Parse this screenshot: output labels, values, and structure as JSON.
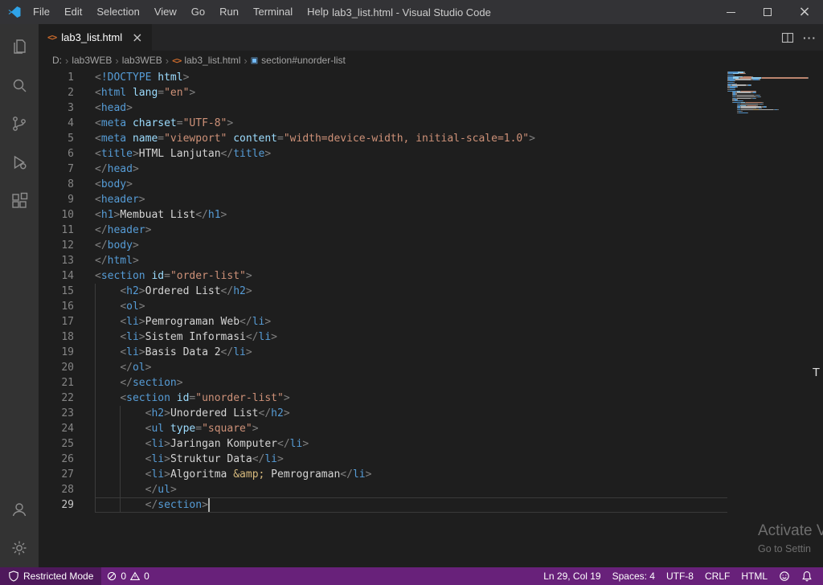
{
  "window": {
    "title": "lab3_list.html - Visual Studio Code",
    "menus": [
      "File",
      "Edit",
      "Selection",
      "View",
      "Go",
      "Run",
      "Terminal",
      "Help"
    ],
    "controls": [
      "minimize",
      "maximize",
      "close"
    ]
  },
  "activity_bar": {
    "top_icons": [
      "explorer",
      "search",
      "source-control",
      "run-and-debug",
      "extensions"
    ],
    "bottom_icons": [
      "accounts",
      "settings"
    ]
  },
  "tabs": {
    "active": {
      "label": "lab3_list.html"
    }
  },
  "breadcrumb": {
    "separator": "›",
    "items": [
      {
        "label": "D:"
      },
      {
        "label": "lab3WEB"
      },
      {
        "label": "lab3WEB"
      },
      {
        "label": "lab3_list.html",
        "icon": "html"
      },
      {
        "label": "section#unorder-list",
        "icon": "symbol"
      }
    ]
  },
  "icons": {
    "html_file_glyph": "<>",
    "symbol_glyph": "▣",
    "close_glyph": "×",
    "more_glyph": "···"
  },
  "editor": {
    "cursor": {
      "line": 29,
      "col": 19
    },
    "lines": [
      [
        [
          "p",
          "<"
        ],
        [
          "tag",
          "!DOCTYPE"
        ],
        [
          "attr",
          " html"
        ],
        [
          "p",
          ">"
        ]
      ],
      [
        [
          "p",
          "<"
        ],
        [
          "tag",
          "html"
        ],
        [
          "attr",
          " lang"
        ],
        [
          "p",
          "="
        ],
        [
          "str",
          "\"en\""
        ],
        [
          "p",
          ">"
        ]
      ],
      [
        [
          "p",
          "<"
        ],
        [
          "tag",
          "head"
        ],
        [
          "p",
          ">"
        ]
      ],
      [
        [
          "p",
          "<"
        ],
        [
          "tag",
          "meta"
        ],
        [
          "attr",
          " charset"
        ],
        [
          "p",
          "="
        ],
        [
          "str",
          "\"UTF-8\""
        ],
        [
          "p",
          ">"
        ]
      ],
      [
        [
          "p",
          "<"
        ],
        [
          "tag",
          "meta"
        ],
        [
          "attr",
          " name"
        ],
        [
          "p",
          "="
        ],
        [
          "str",
          "\"viewport\""
        ],
        [
          "attr",
          " content"
        ],
        [
          "p",
          "="
        ],
        [
          "str",
          "\"width=device-width, initial-scale=1.0\""
        ],
        [
          "p",
          ">"
        ]
      ],
      [
        [
          "p",
          "<"
        ],
        [
          "tag",
          "title"
        ],
        [
          "p",
          ">"
        ],
        [
          "txt",
          "HTML Lanjutan"
        ],
        [
          "p",
          "</"
        ],
        [
          "tag",
          "title"
        ],
        [
          "p",
          ">"
        ]
      ],
      [
        [
          "p",
          "</"
        ],
        [
          "tag",
          "head"
        ],
        [
          "p",
          ">"
        ]
      ],
      [
        [
          "p",
          "<"
        ],
        [
          "tag",
          "body"
        ],
        [
          "p",
          ">"
        ]
      ],
      [
        [
          "p",
          "<"
        ],
        [
          "tag",
          "header"
        ],
        [
          "p",
          ">"
        ]
      ],
      [
        [
          "p",
          "<"
        ],
        [
          "tag",
          "h1"
        ],
        [
          "p",
          ">"
        ],
        [
          "txt",
          "Membuat List"
        ],
        [
          "p",
          "</"
        ],
        [
          "tag",
          "h1"
        ],
        [
          "p",
          ">"
        ]
      ],
      [
        [
          "p",
          "</"
        ],
        [
          "tag",
          "header"
        ],
        [
          "p",
          ">"
        ]
      ],
      [
        [
          "p",
          "</"
        ],
        [
          "tag",
          "body"
        ],
        [
          "p",
          ">"
        ]
      ],
      [
        [
          "p",
          "</"
        ],
        [
          "tag",
          "html"
        ],
        [
          "p",
          ">"
        ]
      ],
      [
        [
          "p",
          "<"
        ],
        [
          "tag",
          "section"
        ],
        [
          "attr",
          " id"
        ],
        [
          "p",
          "="
        ],
        [
          "str",
          "\"order-list\""
        ],
        [
          "p",
          ">"
        ]
      ],
      [
        [
          "ws",
          "    "
        ],
        [
          "p",
          "<"
        ],
        [
          "tag",
          "h2"
        ],
        [
          "p",
          ">"
        ],
        [
          "txt",
          "Ordered List"
        ],
        [
          "p",
          "</"
        ],
        [
          "tag",
          "h2"
        ],
        [
          "p",
          ">"
        ]
      ],
      [
        [
          "ws",
          "    "
        ],
        [
          "p",
          "<"
        ],
        [
          "tag",
          "ol"
        ],
        [
          "p",
          ">"
        ]
      ],
      [
        [
          "ws",
          "    "
        ],
        [
          "p",
          "<"
        ],
        [
          "tag",
          "li"
        ],
        [
          "p",
          ">"
        ],
        [
          "txt",
          "Pemrograman Web"
        ],
        [
          "p",
          "</"
        ],
        [
          "tag",
          "li"
        ],
        [
          "p",
          ">"
        ]
      ],
      [
        [
          "ws",
          "    "
        ],
        [
          "p",
          "<"
        ],
        [
          "tag",
          "li"
        ],
        [
          "p",
          ">"
        ],
        [
          "txt",
          "Sistem Informasi"
        ],
        [
          "p",
          "</"
        ],
        [
          "tag",
          "li"
        ],
        [
          "p",
          ">"
        ]
      ],
      [
        [
          "ws",
          "    "
        ],
        [
          "p",
          "<"
        ],
        [
          "tag",
          "li"
        ],
        [
          "p",
          ">"
        ],
        [
          "txt",
          "Basis Data 2"
        ],
        [
          "p",
          "</"
        ],
        [
          "tag",
          "li"
        ],
        [
          "p",
          ">"
        ]
      ],
      [
        [
          "ws",
          "    "
        ],
        [
          "p",
          "</"
        ],
        [
          "tag",
          "ol"
        ],
        [
          "p",
          ">"
        ]
      ],
      [
        [
          "ws",
          "    "
        ],
        [
          "p",
          "</"
        ],
        [
          "tag",
          "section"
        ],
        [
          "p",
          ">"
        ]
      ],
      [
        [
          "ws",
          "    "
        ],
        [
          "p",
          "<"
        ],
        [
          "tag",
          "section"
        ],
        [
          "attr",
          " id"
        ],
        [
          "p",
          "="
        ],
        [
          "str",
          "\"unorder-list\""
        ],
        [
          "p",
          ">"
        ]
      ],
      [
        [
          "ws",
          "        "
        ],
        [
          "p",
          "<"
        ],
        [
          "tag",
          "h2"
        ],
        [
          "p",
          ">"
        ],
        [
          "txt",
          "Unordered List"
        ],
        [
          "p",
          "</"
        ],
        [
          "tag",
          "h2"
        ],
        [
          "p",
          ">"
        ]
      ],
      [
        [
          "ws",
          "        "
        ],
        [
          "p",
          "<"
        ],
        [
          "tag",
          "ul"
        ],
        [
          "attr",
          " type"
        ],
        [
          "p",
          "="
        ],
        [
          "str",
          "\"square\""
        ],
        [
          "p",
          ">"
        ]
      ],
      [
        [
          "ws",
          "        "
        ],
        [
          "p",
          "<"
        ],
        [
          "tag",
          "li"
        ],
        [
          "p",
          ">"
        ],
        [
          "txt",
          "Jaringan Komputer"
        ],
        [
          "p",
          "</"
        ],
        [
          "tag",
          "li"
        ],
        [
          "p",
          ">"
        ]
      ],
      [
        [
          "ws",
          "        "
        ],
        [
          "p",
          "<"
        ],
        [
          "tag",
          "li"
        ],
        [
          "p",
          ">"
        ],
        [
          "txt",
          "Struktur Data"
        ],
        [
          "p",
          "</"
        ],
        [
          "tag",
          "li"
        ],
        [
          "p",
          ">"
        ]
      ],
      [
        [
          "ws",
          "        "
        ],
        [
          "p",
          "<"
        ],
        [
          "tag",
          "li"
        ],
        [
          "p",
          ">"
        ],
        [
          "txt",
          "Algoritma "
        ],
        [
          "ent",
          "&amp;"
        ],
        [
          "txt",
          " Pemrograman"
        ],
        [
          "p",
          "</"
        ],
        [
          "tag",
          "li"
        ],
        [
          "p",
          ">"
        ]
      ],
      [
        [
          "ws",
          "        "
        ],
        [
          "p",
          "</"
        ],
        [
          "tag",
          "ul"
        ],
        [
          "p",
          ">"
        ]
      ],
      [
        [
          "ws",
          "        "
        ],
        [
          "p",
          "</"
        ],
        [
          "tag",
          "section"
        ],
        [
          "p",
          ">"
        ]
      ]
    ]
  },
  "status_bar": {
    "restricted_label": "Restricted Mode",
    "errors": "0",
    "warnings": "0",
    "right": [
      {
        "name": "cursor-position",
        "label": "Ln 29, Col 19"
      },
      {
        "name": "indentation",
        "label": "Spaces: 4"
      },
      {
        "name": "encoding",
        "label": "UTF-8"
      },
      {
        "name": "eol",
        "label": "CRLF"
      },
      {
        "name": "language-mode",
        "label": "HTML"
      }
    ]
  },
  "overlay": {
    "glyph": "T"
  },
  "watermark": {
    "line1": "Activate V",
    "line2": "Go to Settin"
  },
  "colors": {
    "status_bar": "#68217A",
    "title_bar": "#333336",
    "activity_bar": "#333333",
    "tab_bar": "#252526",
    "editor_bg": "#1E1E1E",
    "html_icon_orange": "#CC6B2C",
    "tag_blue": "#569CD6",
    "attr_blue": "#9CDCFE",
    "string_orange": "#CE9178",
    "punct_gray": "#808080",
    "entity_gold": "#D7BA7D"
  }
}
